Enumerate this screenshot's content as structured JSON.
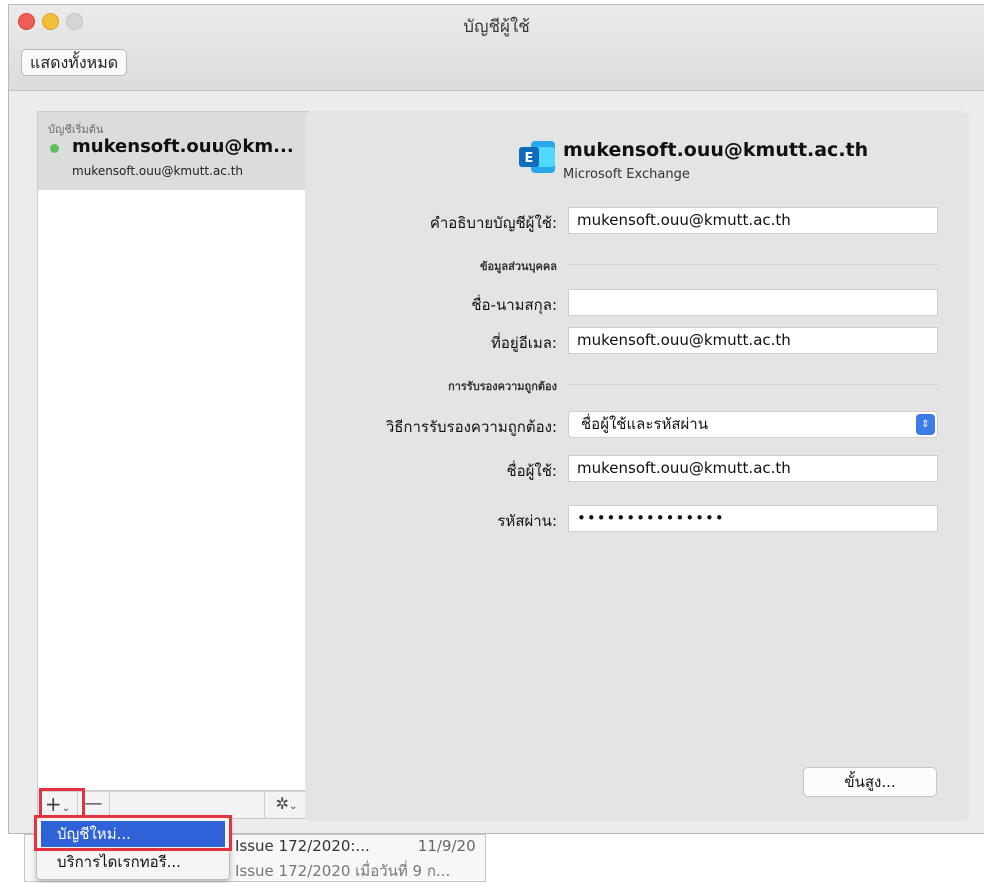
{
  "window": {
    "title": "บัญชีผู้ใช้",
    "show_all": "แสดงทั้งหมด"
  },
  "sidebar": {
    "group_label": "บัญชีเริ่มต้น",
    "account_name": "mukensoft.ouu@km...",
    "account_email": "mukensoft.ouu@kmutt.ac.th",
    "status_color": "#5cc15e",
    "add_icon": "+",
    "remove_icon": "—",
    "gear_icon": "✲"
  },
  "account": {
    "title": "mukensoft.ouu@kmutt.ac.th",
    "type": "Microsoft Exchange",
    "description_label": "คำอธิบายบัญชีผู้ใช้:",
    "description_value": "mukensoft.ouu@kmutt.ac.th",
    "personal_section": "ข้อมูลส่วนบุคคล",
    "fullname_label": "ชื่อ-นามสกุล:",
    "fullname_value": "",
    "email_label": "ที่อยู่อีเมล:",
    "email_value": "mukensoft.ouu@kmutt.ac.th",
    "auth_section": "การรับรองความถูกต้อง",
    "auth_method_label": "วิธีการรับรองความถูกต้อง:",
    "auth_method_value": "ชื่อผู้ใช้และรหัสผ่าน",
    "username_label": "ชื่อผู้ใช้:",
    "username_value": "mukensoft.ouu@kmutt.ac.th",
    "password_label": "รหัสผ่าน:",
    "password_value": "•••••••••••••••",
    "advanced_button": "ขั้นสูง..."
  },
  "menu": {
    "new_account": "บัญชีใหม่...",
    "directory_service": "บริการไดเรกทอรี..."
  },
  "background_list": {
    "row1_subject": "Issue 172/2020:...",
    "row1_date": "11/9/20",
    "row2_subject": "Issue 172/2020 เมื่อวันที่ 9 ก..."
  },
  "colors": {
    "accent": "#2e62d6",
    "highlight_box": "#e2343f",
    "exchange_blue": "#1a7fd4"
  }
}
